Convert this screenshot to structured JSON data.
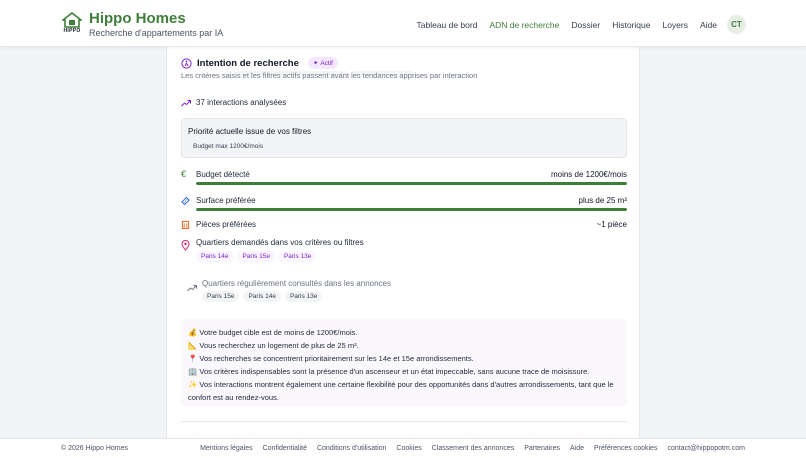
{
  "header": {
    "logo_text": "HIPPO",
    "brand_title": "Hippo Homes",
    "brand_subtitle": "Recherche d'appartements par IA",
    "nav": [
      {
        "label": "Tableau de bord",
        "active": false
      },
      {
        "label": "ADN de recherche",
        "active": true
      },
      {
        "label": "Dossier",
        "active": false
      },
      {
        "label": "Historique",
        "active": false
      },
      {
        "label": "Loyers",
        "active": false
      },
      {
        "label": "Aide",
        "active": false
      }
    ],
    "avatar_initials": "CT"
  },
  "section": {
    "title": "Intention de recherche",
    "badge": "Actif",
    "subtitle": "Les critères saisis et les filtres actifs passent avant les tendances apprises par interaction"
  },
  "interactions": "37 interactions analysées",
  "priority": {
    "title": "Priorité actuelle issue de vos filtres",
    "tag": "Budget max 1200€/mois"
  },
  "metrics": {
    "budget": {
      "label": "Budget détecté",
      "value": "moins de 1200€/mois",
      "level": 1.0
    },
    "surface": {
      "label": "Surface préférée",
      "value": "plus de 25 m²",
      "level": 1.0
    },
    "pieces": {
      "label": "Pièces préférées",
      "value": "~1 pièce"
    }
  },
  "quartiers": {
    "label": "Quartiers demandés dans vos critères ou filtres",
    "items": [
      "Paris 14e",
      "Paris 15e",
      "Paris 13e"
    ]
  },
  "consultes": {
    "label": "Quartiers régulièrement consultés dans les annonces",
    "items": [
      "Paris 15e",
      "Paris 14e",
      "Paris 13e"
    ]
  },
  "insights": [
    "💰 Votre budget cible est de moins de 1200€/mois.",
    "📐 Vous recherchez un logement de plus de 25 m².",
    "📍 Vos recherches se concentrent prioritairement sur les 14e et 15e arrondissements.",
    "🏢 Vos critères indispensables sont la présence d'un ascenseur et un état impeccable, sans aucune trace de moisissure.",
    "✨ Vos interactions montrent également une certaine flexibilité pour des opportunités dans d'autres arrondissements, tant que le confort est au rendez-vous."
  ],
  "footer": {
    "copyright": "© 2026 Hippo Homes",
    "links": [
      "Mentions légales",
      "Confidentialité",
      "Conditions d'utilisation",
      "Cookies",
      "Classement des annonces",
      "Partenaires",
      "Aide",
      "Préférences cookies",
      "contact@hippopotm.com"
    ]
  },
  "colors": {
    "brand": "#3f7d3a",
    "accent_purple": "#7e22ce",
    "bar_fill": "#3f7d3a"
  }
}
